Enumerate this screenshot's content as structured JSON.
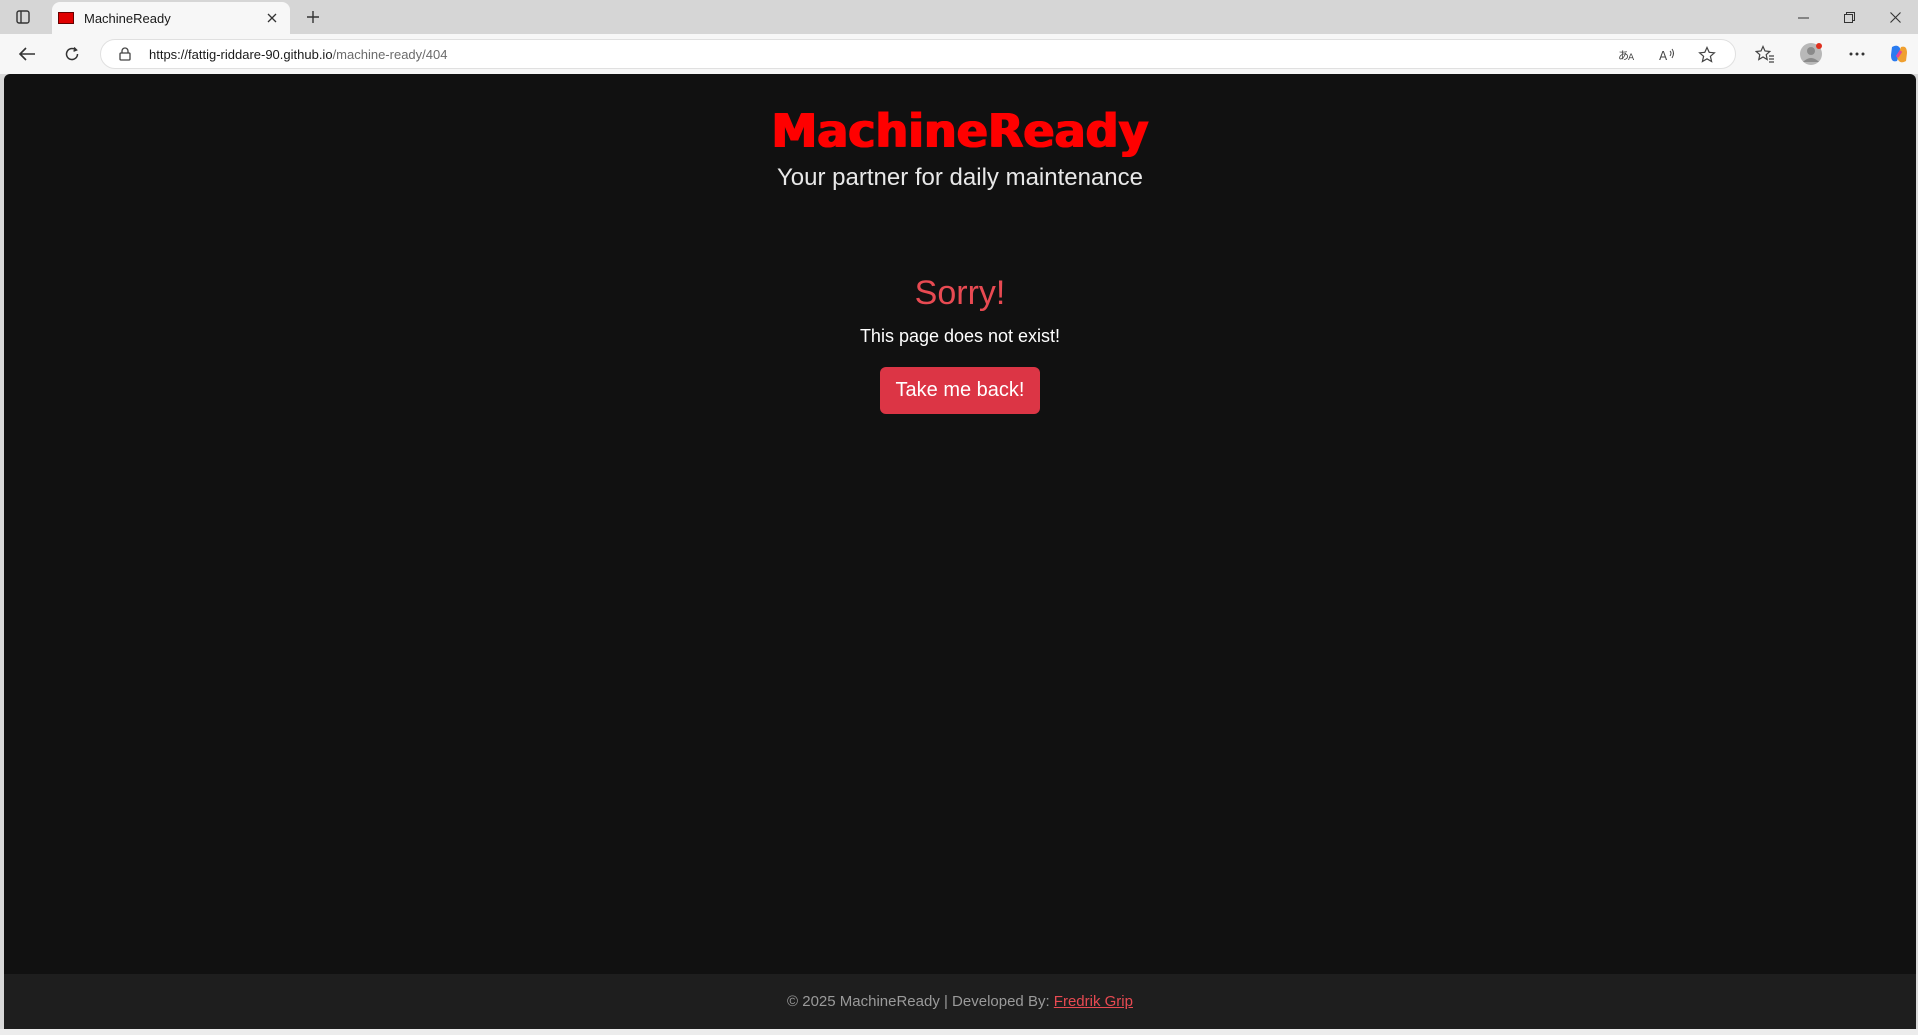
{
  "browser": {
    "tab_title": "MachineReady",
    "url_host": "https://fattig-riddare-90.github.io",
    "url_path": "/machine-ready/404"
  },
  "page": {
    "brand": "MachineReady",
    "tagline": "Your partner for daily maintenance",
    "heading": "Sorry!",
    "message": "This page does not exist!",
    "back_button": "Take me back!"
  },
  "footer": {
    "text": "© 2025 MachineReady | Developed By: ",
    "author_link": "Fredrik Grip"
  },
  "colors": {
    "page_background": "#111111",
    "brand": "#ff0000",
    "accent": "#dc3545",
    "heading": "#e84a52",
    "footer_background": "#1e1e1e"
  },
  "icons": {
    "tab_actions": "tab-actions-icon",
    "close_tab": "close-icon",
    "new_tab": "plus-icon",
    "back": "back-arrow-icon",
    "refresh": "refresh-icon",
    "lock": "lock-icon",
    "translate": "translate-icon",
    "read_aloud": "read-aloud-icon",
    "favorite": "star-icon",
    "favorites": "favorites-icon",
    "profile": "profile-icon",
    "more": "more-icon",
    "copilot": "copilot-icon"
  }
}
